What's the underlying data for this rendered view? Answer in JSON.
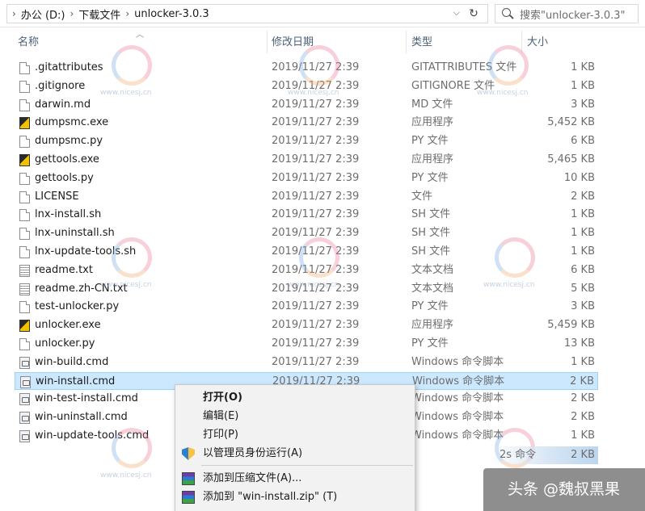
{
  "breadcrumb": {
    "segments": [
      "办公 (D:)",
      "下载文件",
      "unlocker-3.0.3"
    ]
  },
  "search": {
    "placeholder": "搜索\"unlocker-3.0.3\""
  },
  "columns": {
    "name": "名称",
    "date": "修改日期",
    "type": "类型",
    "size": "大小"
  },
  "files": [
    {
      "name": ".gitattributes",
      "date": "2019/11/27 2:39",
      "type": "GITATTRIBUTES 文件",
      "size": "1 KB",
      "icon": "doc"
    },
    {
      "name": ".gitignore",
      "date": "2019/11/27 2:39",
      "type": "GITIGNORE 文件",
      "size": "1 KB",
      "icon": "doc"
    },
    {
      "name": "darwin.md",
      "date": "2019/11/27 2:39",
      "type": "MD 文件",
      "size": "3 KB",
      "icon": "doc"
    },
    {
      "name": "dumpsmc.exe",
      "date": "2019/11/27 2:39",
      "type": "应用程序",
      "size": "5,452 KB",
      "icon": "exe"
    },
    {
      "name": "dumpsmc.py",
      "date": "2019/11/27 2:39",
      "type": "PY 文件",
      "size": "6 KB",
      "icon": "doc"
    },
    {
      "name": "gettools.exe",
      "date": "2019/11/27 2:39",
      "type": "应用程序",
      "size": "5,465 KB",
      "icon": "exe"
    },
    {
      "name": "gettools.py",
      "date": "2019/11/27 2:39",
      "type": "PY 文件",
      "size": "10 KB",
      "icon": "doc"
    },
    {
      "name": "LICENSE",
      "date": "2019/11/27 2:39",
      "type": "文件",
      "size": "2 KB",
      "icon": "doc"
    },
    {
      "name": "lnx-install.sh",
      "date": "2019/11/27 2:39",
      "type": "SH 文件",
      "size": "1 KB",
      "icon": "doc"
    },
    {
      "name": "lnx-uninstall.sh",
      "date": "2019/11/27 2:39",
      "type": "SH 文件",
      "size": "1 KB",
      "icon": "doc"
    },
    {
      "name": "lnx-update-tools.sh",
      "date": "2019/11/27 2:39",
      "type": "SH 文件",
      "size": "1 KB",
      "icon": "doc"
    },
    {
      "name": "readme.txt",
      "date": "2019/11/27 2:39",
      "type": "文本文档",
      "size": "6 KB",
      "icon": "text"
    },
    {
      "name": "readme.zh-CN.txt",
      "date": "2019/11/27 2:39",
      "type": "文本文档",
      "size": "5 KB",
      "icon": "text"
    },
    {
      "name": "test-unlocker.py",
      "date": "2019/11/27 2:39",
      "type": "PY 文件",
      "size": "3 KB",
      "icon": "doc"
    },
    {
      "name": "unlocker.exe",
      "date": "2019/11/27 2:39",
      "type": "应用程序",
      "size": "5,459 KB",
      "icon": "exe"
    },
    {
      "name": "unlocker.py",
      "date": "2019/11/27 2:39",
      "type": "PY 文件",
      "size": "13 KB",
      "icon": "doc"
    },
    {
      "name": "win-build.cmd",
      "date": "2019/11/27 2:39",
      "type": "Windows 命令脚本",
      "size": "1 KB",
      "icon": "cmd"
    },
    {
      "name": "win-install.cmd",
      "date": "2019/11/27 2:39",
      "type": "Windows 命令脚本",
      "size": "2 KB",
      "icon": "cmd",
      "selected": true
    },
    {
      "name": "win-test-install.cmd",
      "date": "",
      "type": "Windows 命令脚本",
      "size": "2 KB",
      "icon": "cmd"
    },
    {
      "name": "win-uninstall.cmd",
      "date": "",
      "type": "Windows 命令脚本",
      "size": "2 KB",
      "icon": "cmd"
    },
    {
      "name": "win-update-tools.cmd",
      "date": "",
      "type": "Windows 命令脚本",
      "size": "1 KB",
      "icon": "cmd"
    }
  ],
  "context_menu": {
    "open": "打开(O)",
    "edit": "编辑(E)",
    "print": "打印(P)",
    "run_as_admin": "以管理员身份运行(A)",
    "add_to_archive": "添加到压缩文件(A)...",
    "add_to_zip": "添加到 \"win-install.zip\" (T)"
  },
  "status_overlay": {
    "text": "2s 命令",
    "size": "2 KB"
  },
  "watermark": {
    "text": "www.nicesj.cn"
  },
  "badge": {
    "text": "头条 @魏叔黑果"
  },
  "icons": [
    "chevron-right-icon",
    "refresh-icon",
    "search-icon",
    "file-icon",
    "exe-icon",
    "text-file-icon",
    "cmd-icon",
    "shield-icon",
    "archive-icon"
  ]
}
